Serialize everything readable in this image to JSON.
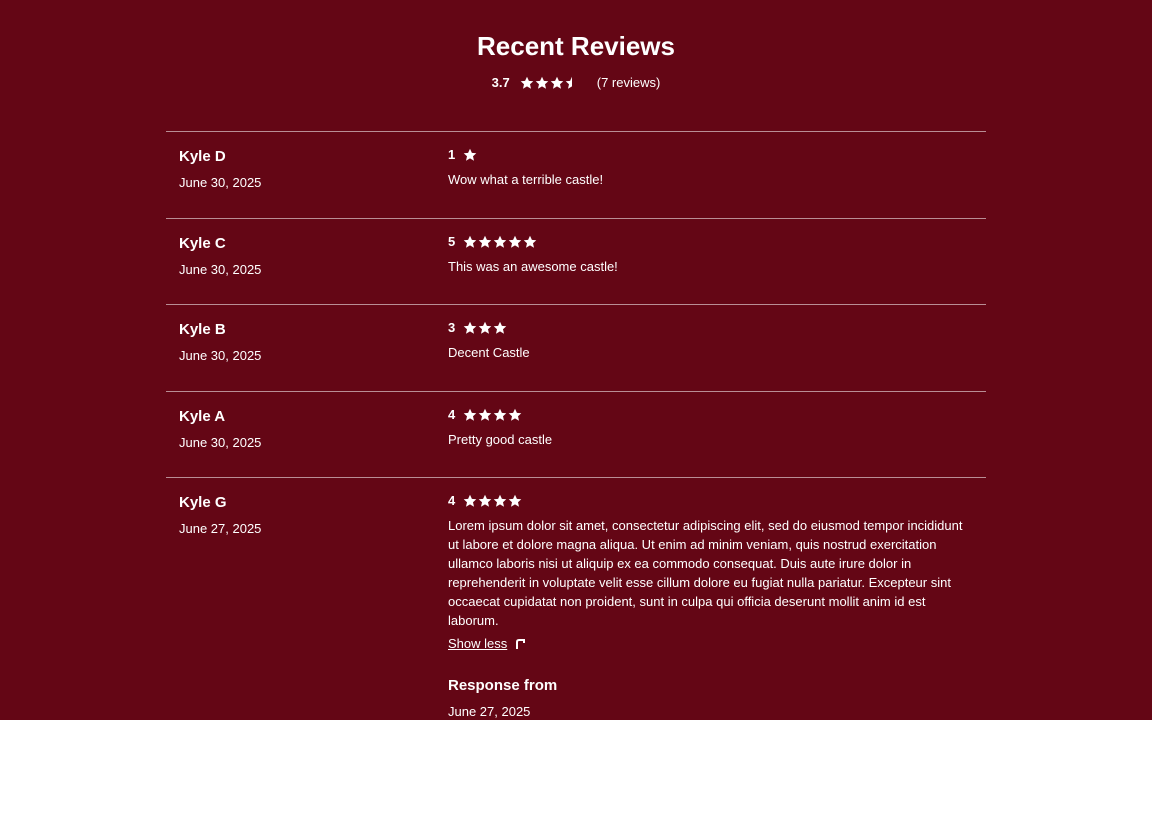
{
  "header": {
    "title": "Recent Reviews",
    "average": "3.7",
    "average_value": 3.5,
    "count_text": "(7 reviews)"
  },
  "reviews": [
    {
      "name": "Kyle D",
      "date": "June 30, 2025",
      "rating_label": "1",
      "rating": 1,
      "text": "Wow what a terrible castle!"
    },
    {
      "name": "Kyle C",
      "date": "June 30, 2025",
      "rating_label": "5",
      "rating": 5,
      "text": "This was an awesome castle!"
    },
    {
      "name": "Kyle B",
      "date": "June 30, 2025",
      "rating_label": "3",
      "rating": 3,
      "text": "Decent Castle"
    },
    {
      "name": "Kyle A",
      "date": "June 30, 2025",
      "rating_label": "4",
      "rating": 4,
      "text": "Pretty good castle"
    },
    {
      "name": "Kyle G",
      "date": "June 27, 2025",
      "rating_label": "4",
      "rating": 4,
      "text": "Lorem ipsum dolor sit amet, consectetur adipiscing elit, sed do eiusmod tempor incididunt ut labore et dolore magna aliqua. Ut enim ad minim veniam, quis nostrud exercitation ullamco laboris nisi ut aliquip ex ea commodo consequat. Duis aute irure dolor in reprehenderit in voluptate velit esse cillum dolore eu fugiat nulla pariatur. Excepteur sint occaecat cupidatat non proident, sunt in culpa qui officia deserunt mollit anim id est laborum.",
      "show_less_label": "Show less",
      "response_title": "Response from",
      "response_date": "June 27, 2025"
    }
  ],
  "colors": {
    "background": "#640615",
    "text": "#ffffff",
    "divider": "#c9a2a8"
  },
  "icons": {
    "star": "star-icon",
    "half_star": "half-star-icon",
    "cursor": "cursor-icon"
  }
}
